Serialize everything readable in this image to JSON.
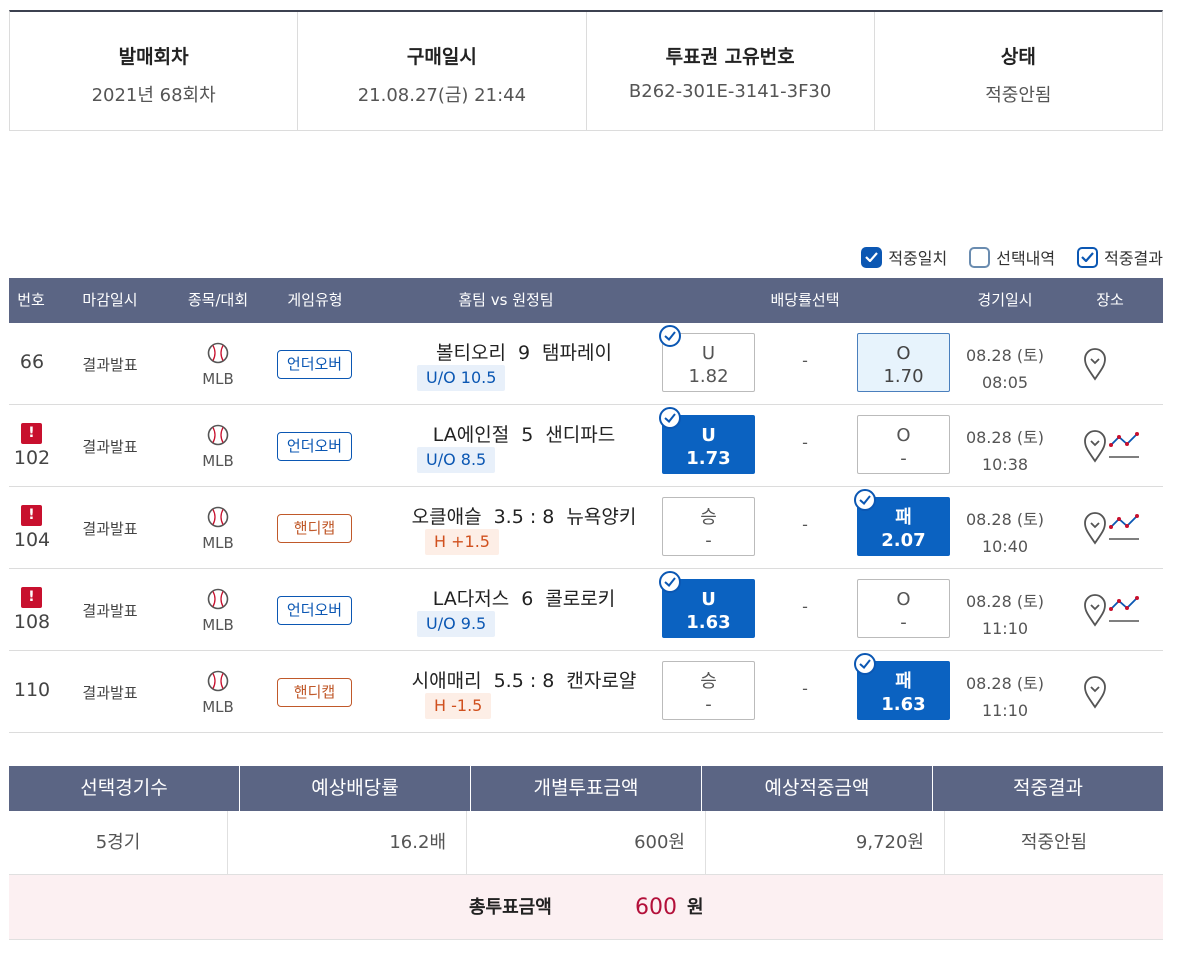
{
  "info": [
    {
      "label": "발매회차",
      "value": "2021년 68회차"
    },
    {
      "label": "구매일시",
      "value": "21.08.27(금) 21:44"
    },
    {
      "label": "투표권 고유번호",
      "value": "B262-301E-3141-3F30"
    },
    {
      "label": "상태",
      "value": "적중안됨"
    }
  ],
  "legend": [
    {
      "label": "적중일치",
      "checked": true
    },
    {
      "label": "선택내역",
      "checked": false
    },
    {
      "label": "적중결과",
      "checked": true
    }
  ],
  "table_headers": [
    "번호",
    "마감일시",
    "종목/대회",
    "게임유형",
    "홈팀 vs 원정팀",
    "배당률선택",
    "경기일시",
    "장소"
  ],
  "rows": [
    {
      "num": "66",
      "warn": false,
      "deadline": "결과발표",
      "league": "MLB",
      "type": "언더오버",
      "type_kind": "uo",
      "home": "볼티오리",
      "score": "9",
      "away": "탬파레이",
      "tag": "U/O 10.5",
      "left_top": "U",
      "left_bottom": "1.82",
      "left_style": "plain",
      "left_check": true,
      "mid": "-",
      "right_top": "O",
      "right_bottom": "1.70",
      "right_style": "light",
      "right_check": false,
      "date": "08.28 (토)",
      "time": "08:05",
      "trend": false
    },
    {
      "num": "102",
      "warn": true,
      "deadline": "결과발표",
      "league": "MLB",
      "type": "언더오버",
      "type_kind": "uo",
      "home": "LA에인절",
      "score": "5",
      "away": "샌디파드",
      "tag": "U/O 8.5",
      "left_top": "U",
      "left_bottom": "1.73",
      "left_style": "picked",
      "left_check": true,
      "mid": "-",
      "right_top": "O",
      "right_bottom": "-",
      "right_style": "plain",
      "right_check": false,
      "date": "08.28 (토)",
      "time": "10:38",
      "trend": true
    },
    {
      "num": "104",
      "warn": true,
      "deadline": "결과발표",
      "league": "MLB",
      "type": "핸디캡",
      "type_kind": "hc",
      "home": "오클애슬",
      "score": "3.5 : 8",
      "away": "뉴욕양키",
      "tag": "H +1.5",
      "left_top": "승",
      "left_bottom": "-",
      "left_style": "plain",
      "left_check": false,
      "mid": "-",
      "right_top": "패",
      "right_bottom": "2.07",
      "right_style": "picked",
      "right_check": true,
      "date": "08.28 (토)",
      "time": "10:40",
      "trend": true
    },
    {
      "num": "108",
      "warn": true,
      "deadline": "결과발표",
      "league": "MLB",
      "type": "언더오버",
      "type_kind": "uo",
      "home": "LA다저스",
      "score": "6",
      "away": "콜로로키",
      "tag": "U/O 9.5",
      "left_top": "U",
      "left_bottom": "1.63",
      "left_style": "picked",
      "left_check": true,
      "mid": "-",
      "right_top": "O",
      "right_bottom": "-",
      "right_style": "plain",
      "right_check": false,
      "date": "08.28 (토)",
      "time": "11:10",
      "trend": true
    },
    {
      "num": "110",
      "warn": false,
      "deadline": "결과발표",
      "league": "MLB",
      "type": "핸디캡",
      "type_kind": "hc",
      "home": "시애매리",
      "score": "5.5 : 8",
      "away": "캔자로얄",
      "tag": "H -1.5",
      "left_top": "승",
      "left_bottom": "-",
      "left_style": "plain",
      "left_check": false,
      "mid": "-",
      "right_top": "패",
      "right_bottom": "1.63",
      "right_style": "picked",
      "right_check": true,
      "date": "08.28 (토)",
      "time": "11:10",
      "trend": false
    }
  ],
  "summary": {
    "headers": [
      "선택경기수",
      "예상배당률",
      "개별투표금액",
      "예상적중금액",
      "적중결과"
    ],
    "values": [
      "5경기",
      "16.2배",
      "600원",
      "9,720원",
      "적중안됨"
    ],
    "total_label": "총투표금액",
    "total_amount": "600",
    "total_unit": "원"
  },
  "colors": {
    "header_bg": "#5b6584",
    "picked": "#0b62c1",
    "warn": "#c8102e",
    "total_amount": "#b3103a"
  },
  "icons": {
    "sport": "baseball-icon",
    "venue": "map-pin-icon",
    "trend": "trend-chart-icon",
    "warn": "exclamation-icon"
  }
}
